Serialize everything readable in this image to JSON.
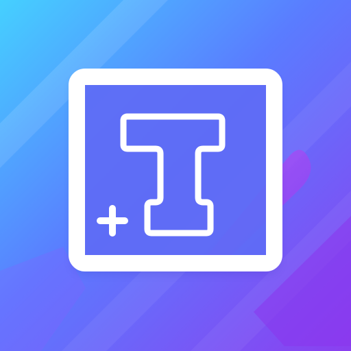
{
  "app": {
    "icon_name": "text-add-icon",
    "colors": {
      "gradient_start": "#45d0ff",
      "gradient_mid": "#5a7cff",
      "gradient_end": "#8b3ff0",
      "accent_blob": "#a04bf3",
      "stroke": "#ffffff",
      "inner_box": "#5f6cf6"
    }
  }
}
